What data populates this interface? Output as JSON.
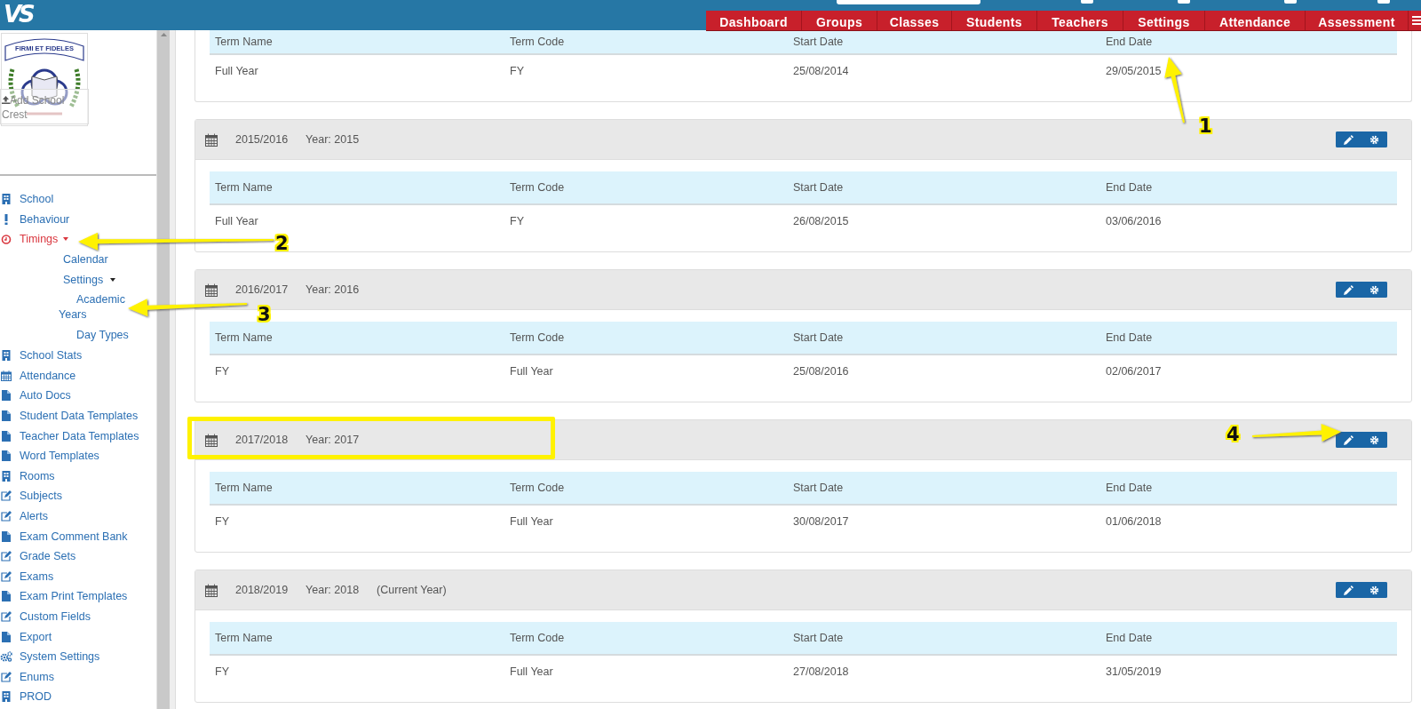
{
  "header": {
    "logo": "VS",
    "nav": [
      {
        "label": "Dashboard",
        "selected": false
      },
      {
        "label": "Groups",
        "selected": false
      },
      {
        "label": "Classes",
        "selected": false
      },
      {
        "label": "Students",
        "selected": false
      },
      {
        "label": "Teachers",
        "selected": false
      },
      {
        "label": "Settings",
        "selected": false
      },
      {
        "label": "Attendance",
        "selected": false
      },
      {
        "label": "Assessment",
        "selected": false
      }
    ]
  },
  "sidebar": {
    "crest": {
      "motto": "FIRMI ET FIDELES",
      "upload_label": "Add School Crest"
    },
    "items": [
      {
        "label": "School",
        "kind": "building",
        "selected": false
      },
      {
        "label": "Behaviour",
        "kind": "alert",
        "selected": false
      },
      {
        "label": "Timings",
        "kind": "clock",
        "selected": true,
        "expanded": true,
        "children": [
          {
            "label": "Calendar",
            "selected": false
          },
          {
            "label": "Settings",
            "selected": false,
            "expanded": true,
            "children": [
              {
                "label": "Academic Years",
                "selected": false
              },
              {
                "label": "Day Types",
                "selected": false
              }
            ]
          }
        ]
      },
      {
        "label": "School Stats",
        "kind": "building",
        "selected": false
      },
      {
        "label": "Attendance",
        "kind": "calendar",
        "selected": false
      },
      {
        "label": "Auto Docs",
        "kind": "document",
        "selected": false
      },
      {
        "label": "Student Data Templates",
        "kind": "document",
        "selected": false
      },
      {
        "label": "Teacher Data Templates",
        "kind": "document",
        "selected": false
      },
      {
        "label": "Word Templates",
        "kind": "document",
        "selected": false
      },
      {
        "label": "Rooms",
        "kind": "building",
        "selected": false
      },
      {
        "label": "Subjects",
        "kind": "edit",
        "selected": false
      },
      {
        "label": "Alerts",
        "kind": "edit",
        "selected": false
      },
      {
        "label": "Exam Comment Bank",
        "kind": "document",
        "selected": false
      },
      {
        "label": "Grade Sets",
        "kind": "edit",
        "selected": false
      },
      {
        "label": "Exams",
        "kind": "edit",
        "selected": false
      },
      {
        "label": "Exam Print Templates",
        "kind": "document",
        "selected": false
      },
      {
        "label": "Custom Fields",
        "kind": "edit",
        "selected": false
      },
      {
        "label": "Export",
        "kind": "document",
        "selected": false
      },
      {
        "label": "System Settings",
        "kind": "cogs",
        "selected": false
      },
      {
        "label": "Enums",
        "kind": "edit",
        "selected": false
      },
      {
        "label": "PROD",
        "kind": "building",
        "selected": false
      }
    ]
  },
  "academic_years": [
    {
      "columns": [
        "Term Name",
        "Term Code",
        "Start Date",
        "End Date"
      ],
      "rows": [
        [
          "Full Year",
          "FY",
          "25/08/2014",
          "29/05/2015"
        ]
      ]
    },
    {
      "name": "2015/2016",
      "year": "Year: 2015",
      "columns": [
        "Term Name",
        "Term Code",
        "Start Date",
        "End Date"
      ],
      "rows": [
        [
          "Full Year",
          "FY",
          "26/08/2015",
          "03/06/2016"
        ]
      ]
    },
    {
      "name": "2016/2017",
      "year": "Year: 2016",
      "columns": [
        "Term Name",
        "Term Code",
        "Start Date",
        "End Date"
      ],
      "rows": [
        [
          "FY",
          "Full Year",
          "25/08/2016",
          "02/06/2017"
        ]
      ]
    },
    {
      "name": "2017/2018",
      "year": "Year: 2017",
      "highlighted": true,
      "columns": [
        "Term Name",
        "Term Code",
        "Start Date",
        "End Date"
      ],
      "rows": [
        [
          "FY",
          "Full Year",
          "30/08/2017",
          "01/06/2018"
        ]
      ]
    },
    {
      "name": "2018/2019",
      "year": "Year: 2018",
      "note": "(Current Year)",
      "columns": [
        "Term Name",
        "Term Code",
        "Start Date",
        "End Date"
      ],
      "rows": [
        [
          "FY",
          "Full Year",
          "27/08/2018",
          "31/05/2019"
        ]
      ]
    }
  ],
  "annotations": [
    {
      "label": "1"
    },
    {
      "label": "2"
    },
    {
      "label": "3"
    },
    {
      "label": "4"
    }
  ]
}
